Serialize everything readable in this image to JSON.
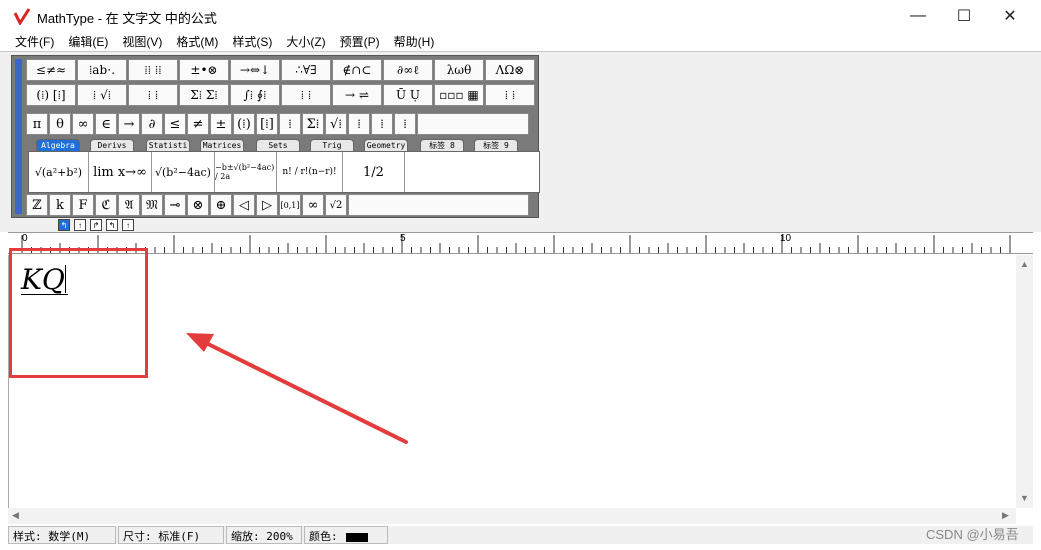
{
  "window": {
    "title": "MathType - 在 文字文 中的公式",
    "minimize_glyph": "—",
    "maximize_glyph": "☐",
    "close_glyph": "✕"
  },
  "menu": [
    "文件(F)",
    "编辑(E)",
    "视图(V)",
    "格式(M)",
    "样式(S)",
    "大小(Z)",
    "预置(P)",
    "帮助(H)"
  ],
  "palette": {
    "row1": [
      "≤≠≈",
      "⁞ab⋅.",
      "⁞⁞ ⁞⁞",
      "±•⊗",
      "→⇔↓",
      "∴∀∃",
      "∉∩⊂",
      "∂∞ℓ",
      "λωθ",
      "ΛΩ⊗"
    ],
    "row2": [
      "(⁞) [⁞]",
      "⁞ √⁞",
      "⁞ ⁞",
      "Σ⁞ Σ⁞",
      "∫⁞ ∮⁞",
      "⁞ ⁞",
      "→ ⇌",
      "Ū Ụ",
      "▫▫▫ ▦",
      "⁞ ⁞"
    ],
    "symbols": [
      "π",
      "θ",
      "∞",
      "∈",
      "→",
      "∂",
      "≤",
      "≠",
      "±",
      "(⁞)",
      "[⁞]",
      "⁞",
      "Σ⁞",
      "√⁞",
      "⁞",
      "⁞",
      "⁞"
    ],
    "tabs": [
      "Algebra",
      "Derivs",
      "Statisti",
      "Matrices",
      "Sets",
      "Trig",
      "Geometry",
      "标签 8",
      "标签 9"
    ],
    "templates": [
      "√(a²+b²)",
      "lim x→∞",
      "√(b²−4ac)",
      "−b±√(b²−4ac) / 2a",
      "n! / r!(n−r)!",
      "1/2"
    ],
    "bottom": [
      "ℤ",
      "k",
      "F",
      "ℭ",
      "𝔄",
      "𝔐",
      "⊸",
      "⊗",
      "⊕",
      "◁",
      "▷",
      "[0,1]",
      "∞",
      "√2"
    ]
  },
  "ruler": {
    "labels": [
      "0",
      "5",
      "10"
    ]
  },
  "equation": "KQ",
  "status": {
    "style": "样式: 数学(M)",
    "size": "尺寸: 标准(F)",
    "zoom": "缩放: 200%",
    "color_label": "颜色:"
  },
  "watermark": "CSDN @小易吾",
  "colors": {
    "highlight": "#e23c3c",
    "active_tab": "#1e6fd9"
  }
}
